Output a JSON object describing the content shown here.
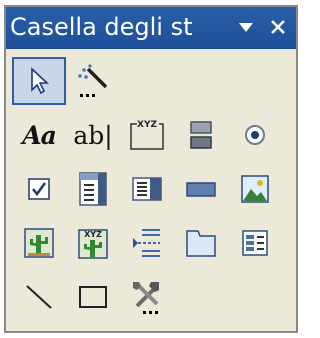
{
  "window": {
    "title": "Casella degli st",
    "menu_glyph": "▼",
    "close_glyph": "✕"
  },
  "tools": {
    "label_text": "Aa",
    "textbox_text": "ab|",
    "group_box_text": "XYZ",
    "option_group_text": "XYZ"
  }
}
